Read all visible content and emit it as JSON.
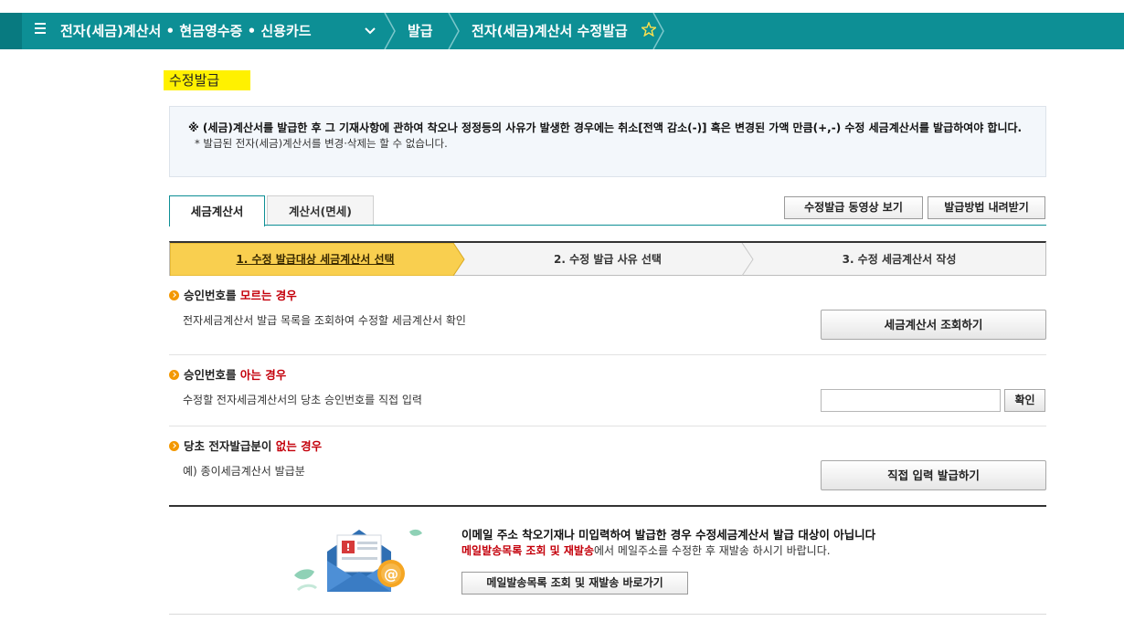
{
  "nav": {
    "menu_title": "전자(세금)계산서 • 현금영수증 • 신용카드",
    "breadcrumb_issue": "발급",
    "breadcrumb_current": "전자(세금)계산서 수정발급"
  },
  "page_title": "수정발급",
  "notice": {
    "main": "※ (세금)계산서를 발급한 후 그 기재사항에 관하여 착오나 정정등의 사유가 발생한 경우에는 취소[전액 감소(-)] 혹은 변경된 가액 만큼(+,-) 수정 세금계산서를 발급하여야 합니다.",
    "sub": "* 발급된 전자(세금)계산서를 변경·삭제는 할 수 없습니다."
  },
  "tabs": [
    {
      "label": "세금계산서",
      "active": true
    },
    {
      "label": "계산서(면세)",
      "active": false
    }
  ],
  "top_buttons": {
    "video": "수정발급 동영상 보기",
    "download": "발급방법 내려받기"
  },
  "steps": [
    {
      "label": "1. 수정 발급대상 세금계산서 선택",
      "active": true
    },
    {
      "label": "2. 수정 발급 사유 선택",
      "active": false
    },
    {
      "label": "3. 수정 세금계산서 작성",
      "active": false
    }
  ],
  "sections": {
    "unknown": {
      "title_prefix": "승인번호를 ",
      "title_highlight": "모르는 경우",
      "desc": "전자세금계산서 발급 목록을 조회하여 수정할 세금계산서 확인",
      "button": "세금계산서 조회하기"
    },
    "known": {
      "title_prefix": "승인번호를 ",
      "title_highlight": "아는 경우",
      "desc": "수정할 전자세금계산서의 당초 승인번호를 직접 입력",
      "input_value": "",
      "button": "확인"
    },
    "none": {
      "title_prefix": "당초 전자발급분이 ",
      "title_highlight": "없는 경우",
      "desc": "예) 종이세금계산서 발급분",
      "button": "직접 입력 발급하기"
    }
  },
  "email": {
    "main": "이메일 주소 착오기재나 미입력하여 발급한 경우 수정세금계산서 발급 대상이 아닙니다",
    "sub_highlight": "메일발송목록 조회 및 재발송",
    "sub_rest": "에서 메일주소를 수정한 후 재발송 하시기 바랍니다.",
    "button": "메일발송목록 조회 및 재발송 바로가기"
  },
  "colors": {
    "nav_bg": "#0d8f95",
    "title_highlight": "#fff100",
    "step_active": "#f9cf4f",
    "accent_red": "#c4000b",
    "bullet": "#f39800"
  }
}
